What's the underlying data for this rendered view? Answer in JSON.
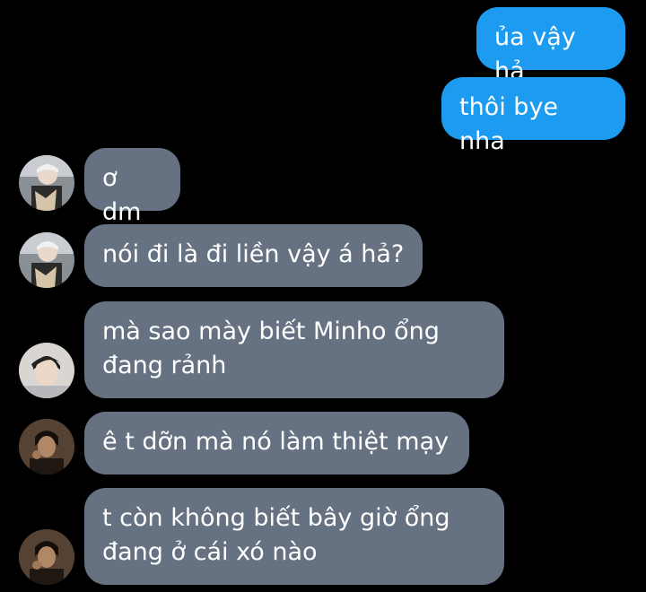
{
  "conversation": {
    "sent": [
      {
        "text": "ủa vậy hả"
      },
      {
        "text": "thôi bye nha"
      }
    ],
    "received": [
      {
        "text": "ơ dm",
        "avatar": "avatar-photo-1"
      },
      {
        "text": "nói đi là đi liền vậy á hả?",
        "avatar": "avatar-photo-1"
      },
      {
        "text": "mà sao mày biết Minho ổng\nđang rảnh",
        "avatar": "avatar-photo-2"
      },
      {
        "text": "ê t dỡn mà nó làm thiệt mạy",
        "avatar": "avatar-photo-3"
      },
      {
        "text": "t còn không biết bây giờ ổng\nđang ở cái xó nào",
        "avatar": "avatar-photo-3"
      }
    ]
  },
  "colors": {
    "background": "#000000",
    "sent_bubble": "#1d9bf0",
    "received_bubble": "#667281",
    "text": "#ffffff"
  }
}
